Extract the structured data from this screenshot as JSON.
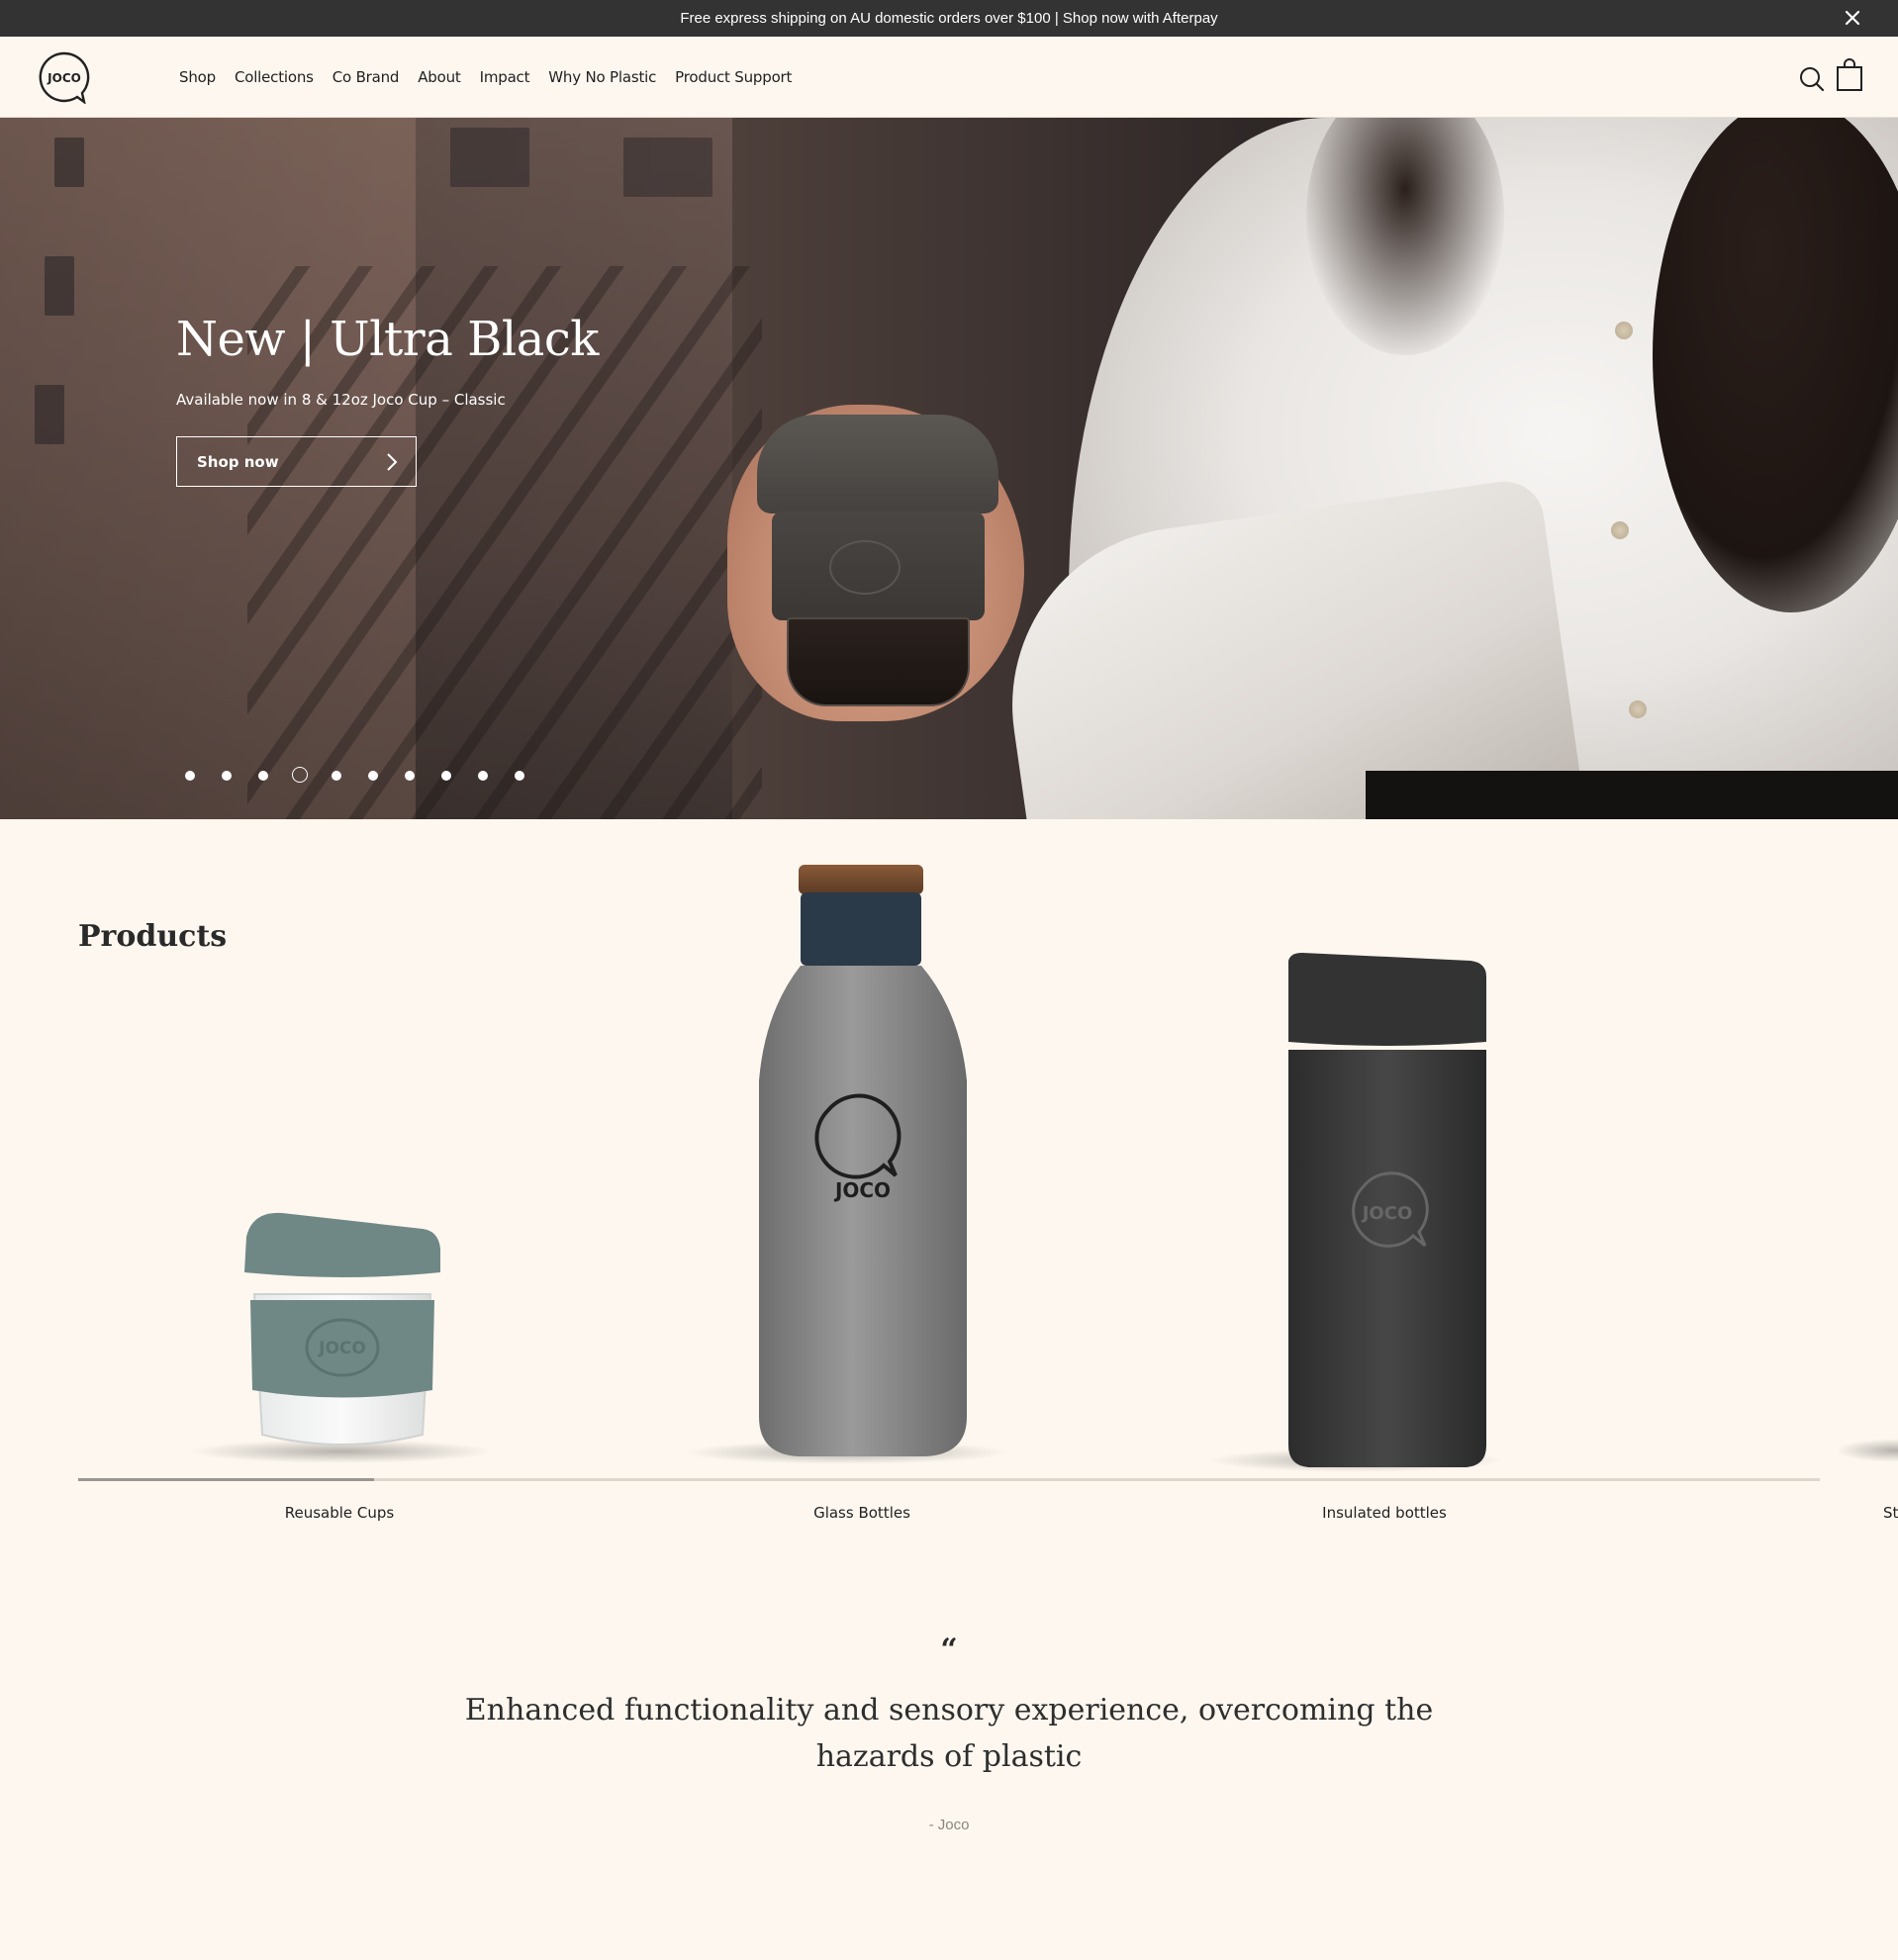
{
  "announcement": {
    "text": "Free express shipping on AU domestic orders over $100 | Shop now with Afterpay",
    "close_icon": "close-icon"
  },
  "header": {
    "logo_text": "JOCO",
    "nav": [
      "Shop",
      "Collections",
      "Co Brand",
      "About",
      "Impact",
      "Why No Plastic",
      "Product Support"
    ],
    "icons": [
      "search-icon",
      "cart-icon"
    ]
  },
  "hero": {
    "title": "New | Ultra Black",
    "subtitle": "Available now in 8 & 12oz Joco Cup – Classic",
    "button_label": "Shop now",
    "slide_count": 10,
    "active_slide": 4
  },
  "products": {
    "title": "Products",
    "items": [
      {
        "label": "Reusable Cups",
        "logo": "JOCO"
      },
      {
        "label": "Glass Bottles",
        "logo": "JOCO"
      },
      {
        "label": "Insulated bottles",
        "logo": "JOCO"
      },
      {
        "label": "St"
      }
    ],
    "scroll_progress": 0.17
  },
  "quote": {
    "mark": "“",
    "text": "Enhanced functionality and sensory experience, overcoming the hazards of plastic",
    "author": "- Joco"
  },
  "colors": {
    "background": "#fdf7ef",
    "announcement_bg": "#333333",
    "text": "#2a2a2a"
  }
}
